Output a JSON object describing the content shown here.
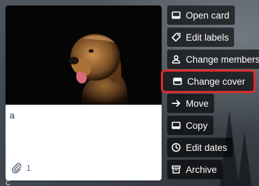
{
  "background": {
    "top_letter": "",
    "bottom_letter": "c"
  },
  "card": {
    "title": "a",
    "cover_image": "golden-retriever-dog-on-black",
    "attachments_count": "1"
  },
  "menu": {
    "items": [
      {
        "label": "Open card",
        "icon": "card-icon"
      },
      {
        "label": "Edit labels",
        "icon": "label-icon"
      },
      {
        "label": "Change members",
        "icon": "member-icon"
      },
      {
        "label": "Change cover",
        "icon": "cover-icon",
        "highlighted": true
      },
      {
        "label": "Move",
        "icon": "arrow-right-icon"
      },
      {
        "label": "Copy",
        "icon": "copy-icon"
      },
      {
        "label": "Edit dates",
        "icon": "clock-icon"
      },
      {
        "label": "Archive",
        "icon": "archive-icon"
      }
    ]
  },
  "colors": {
    "highlight": "#e02b2b",
    "menu_bg": "rgba(0,0,0,0.62)",
    "card_bg": "#ffffff"
  }
}
